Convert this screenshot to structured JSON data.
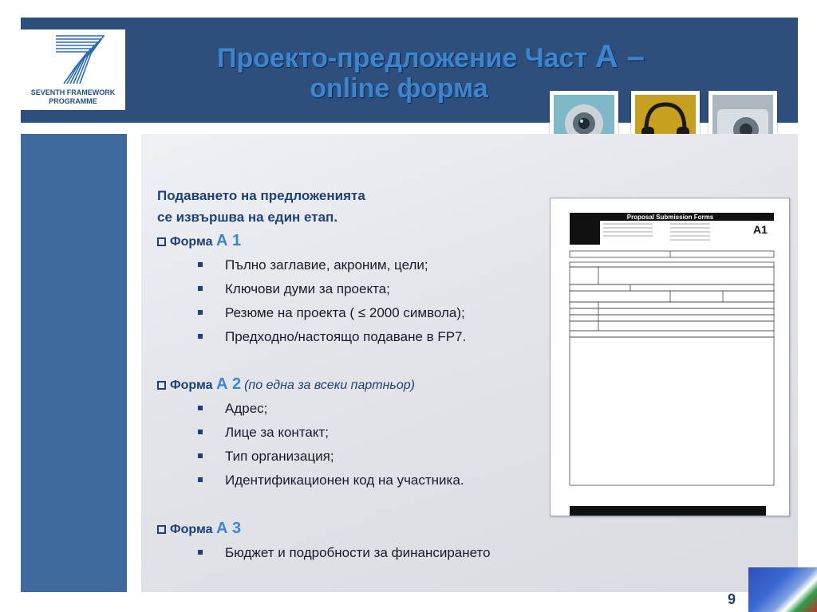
{
  "logo": {
    "line1": "SEVENTH FRAMEWORK",
    "line2": "PROGRAMME"
  },
  "title": {
    "line1": "Проекто-предложение Част",
    "part_letter": "А –",
    "line2": "online форма"
  },
  "intro": {
    "line1": "Подаването на предложенията",
    "line2": "се извършва на един етап."
  },
  "forms": [
    {
      "label": "Форма",
      "code": "А 1",
      "note": "",
      "items": [
        "Пълно заглавие, акроним, цели;",
        "Ключови думи за проекта;",
        "Резюме на проекта ( ≤ 2000 символа);",
        "Предходно/настоящо подаване в FP7."
      ]
    },
    {
      "label": "Форма",
      "code": "А 2",
      "note": "(по една за всеки партньор)",
      "items": [
        "Адрес;",
        "Лице за контакт;",
        "Тип организация;",
        "Идентификационен код на участника."
      ]
    },
    {
      "label": "Форма",
      "code": "А 3",
      "note": "",
      "items": [
        "Бюджет и подробности за финансирането"
      ]
    }
  ],
  "document_preview": {
    "header": "Proposal Submission Forms",
    "code": "A1"
  },
  "page_number": "9",
  "colors": {
    "header_bg": "#2e4f7c",
    "title": "#3d86cf",
    "side_band": "#3e6a9c",
    "content_bg": "#e3e5ea",
    "text_dark_blue": "#1f3f78"
  },
  "icons": [
    "fp7-logo",
    "webcam-image",
    "headphones-image",
    "camera-image",
    "eu-bg-flag-image"
  ]
}
